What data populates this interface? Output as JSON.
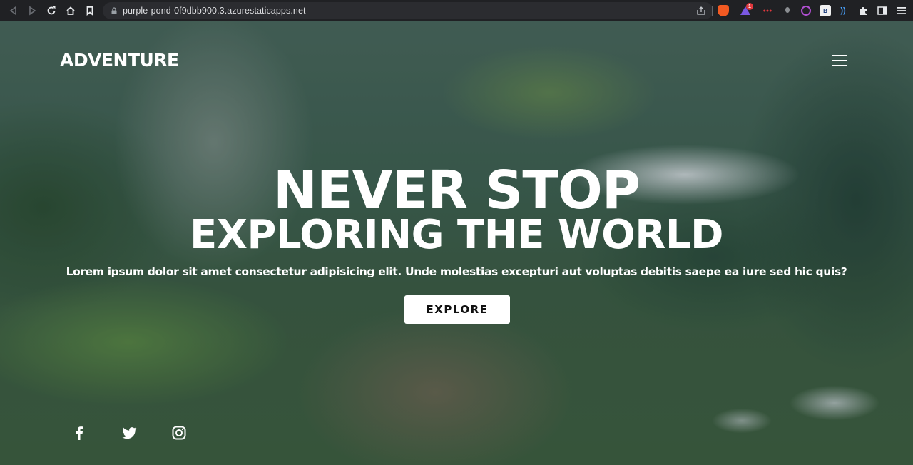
{
  "browser": {
    "url": "purple-pond-0f9dbb900.3.azurestaticapps.net",
    "brave_badge": "1",
    "ext_label_b": "B"
  },
  "site": {
    "brand": "ADVENTURE",
    "hero": {
      "line1": "NEVER STOP",
      "line2": "EXPLORING THE WORLD",
      "subtitle": "Lorem ipsum dolor sit amet consectetur adipisicing elit. Unde molestias excepturi aut voluptas debitis saepe ea iure sed hic quis?",
      "cta": "EXPLORE"
    },
    "socials": [
      "facebook-icon",
      "twitter-icon",
      "instagram-icon"
    ]
  },
  "colors": {
    "text": "#ffffff",
    "button_bg": "#ffffff",
    "button_text": "#111111",
    "browser_bar": "#202124"
  }
}
